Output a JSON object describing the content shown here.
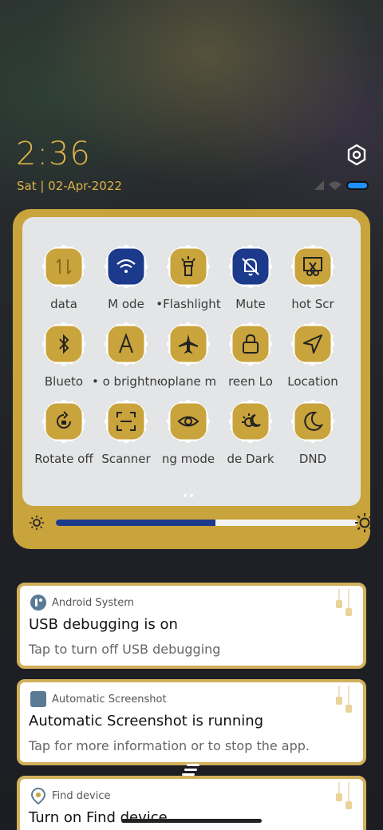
{
  "status": {
    "time": "2:36",
    "date": "Sat | 02-Apr-2022",
    "battery_color": "#1e90ff",
    "accent": "#e0b24a"
  },
  "quick_settings": {
    "tiles": [
      {
        "label": "data",
        "icon": "mobile-data-icon",
        "active": false
      },
      {
        "label": "M   ode",
        "icon": "wifi-icon",
        "active": true
      },
      {
        "label": "•Flashlight",
        "icon": "flashlight-icon",
        "active": false
      },
      {
        "label": "Mute",
        "icon": "mute-bell-icon",
        "active": true
      },
      {
        "label": "hot   Scr",
        "icon": "screenshot-icon",
        "active": false
      },
      {
        "label": "Blueto",
        "icon": "bluetooth-icon",
        "active": false
      },
      {
        "label": "• o brightne",
        "icon": "auto-brightness-icon",
        "active": false
      },
      {
        "label": "oplane m",
        "icon": "airplane-icon",
        "active": false
      },
      {
        "label": "reen   Lo",
        "icon": "lock-screen-icon",
        "active": false
      },
      {
        "label": "Location",
        "icon": "location-icon",
        "active": false
      },
      {
        "label": "Rotate off",
        "icon": "rotate-lock-icon",
        "active": false
      },
      {
        "label": "Scanner",
        "icon": "scanner-icon",
        "active": false
      },
      {
        "label": "ng mode",
        "icon": "reading-mode-icon",
        "active": false
      },
      {
        "label": "de   Dark",
        "icon": "dark-mode-icon",
        "active": false
      },
      {
        "label": "DND",
        "icon": "dnd-moon-icon",
        "active": false
      }
    ],
    "active_color": "#1c3a8c",
    "inactive_color": "#c9a33b",
    "brightness_fraction": 0.53
  },
  "notifications": [
    {
      "app": "Android System",
      "title": "USB debugging is on",
      "text": "Tap to turn off USB debugging"
    },
    {
      "app": "Automatic Screenshot",
      "title": "Automatic Screenshot is running",
      "text": "Tap for more information or to stop the app."
    },
    {
      "app": "Find device",
      "title": "Turn on Find device",
      "text": ""
    }
  ]
}
